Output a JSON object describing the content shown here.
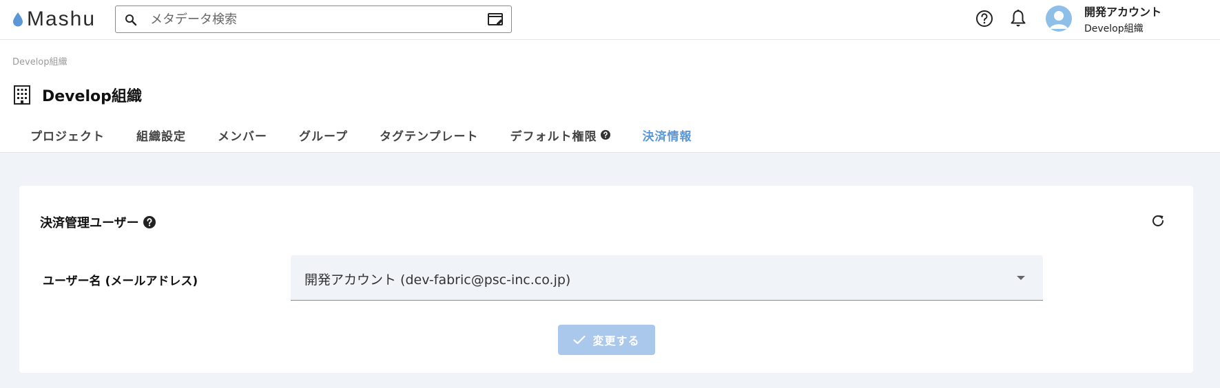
{
  "header": {
    "logo_text": "Mashu",
    "search_placeholder": "メタデータ検索",
    "account_name": "開発アカウント",
    "account_org": "Develop組織",
    "icons": [
      "water-drop-icon",
      "search-icon",
      "advanced-search-icon",
      "help-icon",
      "bell-icon",
      "account-avatar-icon"
    ]
  },
  "page": {
    "breadcrumb": "Develop組織",
    "title": "Develop組織",
    "title_icon": "building-icon"
  },
  "tabs": [
    {
      "label": "プロジェクト"
    },
    {
      "label": "組織設定"
    },
    {
      "label": "メンバー"
    },
    {
      "label": "グループ"
    },
    {
      "label": "タグテンプレート"
    },
    {
      "label": "デフォルト権限",
      "help_icon": true
    },
    {
      "label": "決済情報",
      "active": true
    }
  ],
  "billing": {
    "section_title": "決済管理ユーザー",
    "field_label": "ユーザー名 (メールアドレス)",
    "selected_user": "開発アカウント (dev-fabric@psc-inc.co.jp)",
    "submit_label": "変更する",
    "submit_enabled": false
  },
  "colors": {
    "accent": "#5b96d6",
    "button_disabled": "#a9c8eb",
    "page_bg": "#f0f3f8",
    "avatar": "#8dbfe9"
  }
}
